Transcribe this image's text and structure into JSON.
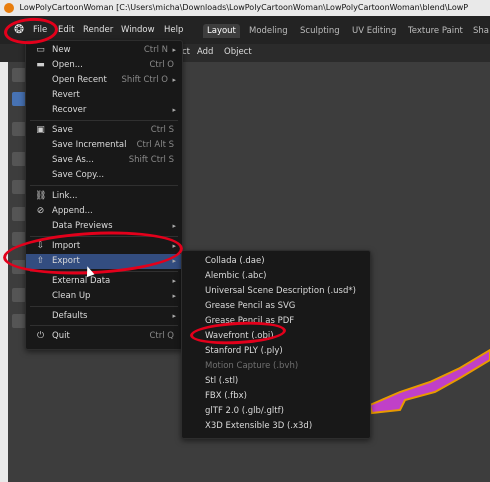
{
  "title_bar": {
    "text": "LowPolyCartoonWoman [C:\\Users\\micha\\Downloads\\LowPolyCartoonWoman\\LowPolyCartoonWoman\\blend\\LowP"
  },
  "menubar": {
    "items": [
      "File",
      "Edit",
      "Render",
      "Window",
      "Help"
    ],
    "workspaces": [
      "Layout",
      "Modeling",
      "Sculpting",
      "UV Editing",
      "Texture Paint",
      "Sha"
    ]
  },
  "header2": {
    "items": [
      "Add",
      "Object"
    ],
    "partial": "ct"
  },
  "file_menu": {
    "items": [
      {
        "label": "New",
        "shortcut": "Ctrl N",
        "icon": "new-file-icon",
        "submenu": true
      },
      {
        "label": "Open...",
        "shortcut": "Ctrl O",
        "icon": "folder-icon"
      },
      {
        "label": "Open Recent",
        "shortcut": "Shift Ctrl O",
        "submenu": true
      },
      {
        "label": "Revert"
      },
      {
        "label": "Recover",
        "submenu": true
      },
      {
        "label": "Save",
        "shortcut": "Ctrl S",
        "icon": "save-icon"
      },
      {
        "label": "Save Incremental",
        "shortcut": "Ctrl Alt S"
      },
      {
        "label": "Save As...",
        "shortcut": "Shift Ctrl S"
      },
      {
        "label": "Save Copy..."
      },
      {
        "label": "Link...",
        "icon": "link-icon"
      },
      {
        "label": "Append...",
        "icon": "append-icon"
      },
      {
        "label": "Data Previews",
        "submenu": true
      },
      {
        "label": "Import",
        "icon": "import-icon",
        "submenu": true
      },
      {
        "label": "Export",
        "icon": "export-icon",
        "submenu": true
      },
      {
        "label": "External Data",
        "submenu": true
      },
      {
        "label": "Clean Up",
        "submenu": true
      },
      {
        "label": "Defaults",
        "submenu": true
      },
      {
        "label": "Quit",
        "shortcut": "Ctrl Q",
        "icon": "power-icon"
      }
    ]
  },
  "export_menu": {
    "items": [
      {
        "label": "Collada (.dae)"
      },
      {
        "label": "Alembic (.abc)"
      },
      {
        "label": "Universal Scene Description (.usd*)"
      },
      {
        "label": "Grease Pencil as SVG"
      },
      {
        "label": "Grease Pencil as PDF"
      },
      {
        "label": "Wavefront (.obj)"
      },
      {
        "label": "Stanford PLY (.ply)"
      },
      {
        "label": "Motion Capture (.bvh)",
        "disabled": true
      },
      {
        "label": "Stl (.stl)"
      },
      {
        "label": "FBX (.fbx)"
      },
      {
        "label": "glTF 2.0 (.glb/.gltf)"
      },
      {
        "label": "X3D Extensible 3D (.x3d)"
      }
    ]
  },
  "colors": {
    "highlight": "#334d80",
    "annotation": "#e3001b",
    "accent": "#4772b3",
    "mesh": "#c040c8"
  }
}
